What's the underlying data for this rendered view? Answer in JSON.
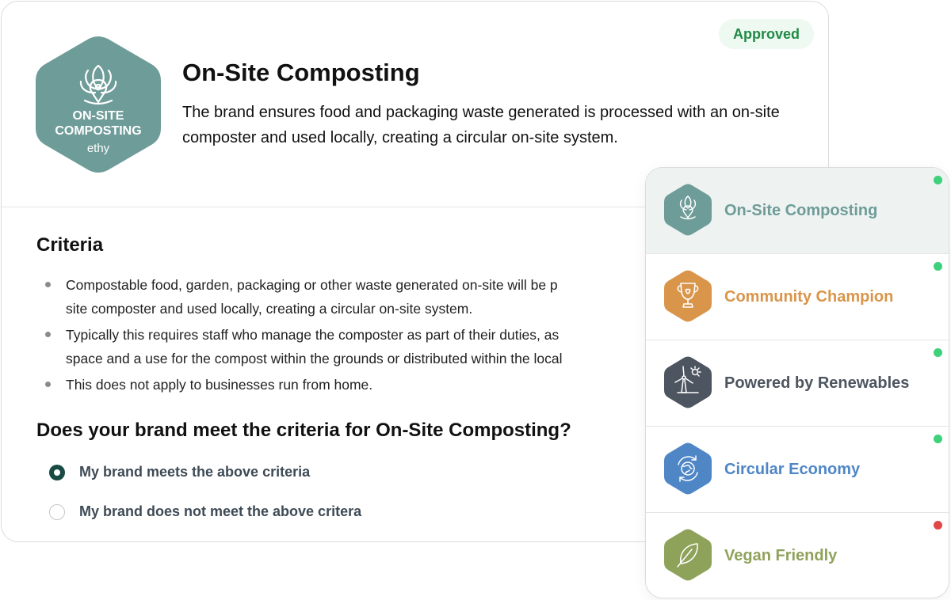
{
  "certification": {
    "status": "Approved",
    "title": "On-Site Composting",
    "description": "The brand ensures food and packaging waste generated is processed with an on-site composter and used locally, creating a circular on-site system.",
    "badge": {
      "line1": "ON-SITE",
      "line2": "COMPOSTING",
      "brand": "ethy",
      "color": "#6e9c99",
      "icon": "lotus-location-pin-icon"
    }
  },
  "criteria": {
    "heading": "Criteria",
    "items": [
      "Compostable food, garden, packaging or other waste generated on-site will be p",
      "site composter and used locally, creating a circular on-site system.",
      "Typically this requires staff who manage the composter as part of their duties, as",
      "space and a use for the compost within the grounds or distributed within the local",
      "This does not apply to businesses run from home."
    ]
  },
  "question": {
    "text": "Does your brand meet the criteria for On-Site Composting?",
    "options": [
      {
        "label": "My brand meets the above criteria",
        "selected": true
      },
      {
        "label": "My brand does not meet the above critera",
        "selected": false
      }
    ]
  },
  "side_panel": {
    "items": [
      {
        "label": "On-Site Composting",
        "color": "#6e9c99",
        "icon": "lotus-icon",
        "status_color": "#3ed07a",
        "active": true
      },
      {
        "label": "Community Champion",
        "color": "#d9954a",
        "icon": "trophy-heart-icon",
        "status_color": "#3ed07a",
        "active": false
      },
      {
        "label": "Powered by Renewables",
        "color": "#4d5560",
        "icon": "wind-turbine-sun-icon",
        "status_color": "#3ed07a",
        "active": false
      },
      {
        "label": "Circular Economy",
        "color": "#4f86c6",
        "icon": "recycle-globe-icon",
        "status_color": "#3ed07a",
        "active": false
      },
      {
        "label": "Vegan Friendly",
        "color": "#8fa25a",
        "icon": "leaf-icon",
        "status_color": "#e04848",
        "active": false
      }
    ]
  }
}
